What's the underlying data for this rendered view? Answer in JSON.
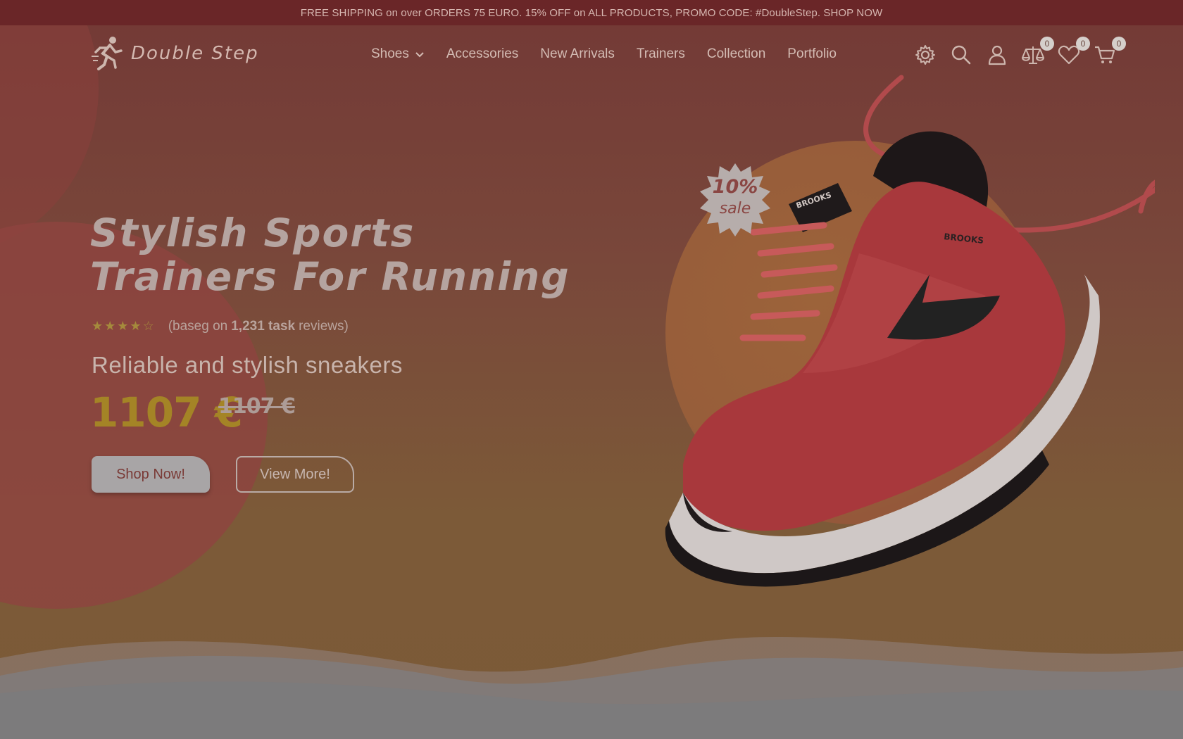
{
  "promo": {
    "text": "FREE SHIPPING on over ORDERS 75 EURO. 15% OFF on ALL PRODUCTS, PROMO CODE: #DoubleStep. SHOP NOW"
  },
  "brand": {
    "name": "Double Step",
    "logo_icon": "runner-icon"
  },
  "nav": {
    "items": [
      {
        "label": "Shoes",
        "has_dropdown": true
      },
      {
        "label": "Accessories"
      },
      {
        "label": "New Arrivals"
      },
      {
        "label": "Trainers"
      },
      {
        "label": "Collection"
      },
      {
        "label": "Portfolio"
      }
    ]
  },
  "header_icons": {
    "settings": {
      "icon": "gear-icon"
    },
    "search": {
      "icon": "search-icon"
    },
    "account": {
      "icon": "user-icon"
    },
    "compare": {
      "icon": "scales-icon",
      "count": "0"
    },
    "wishlist": {
      "icon": "heart-icon",
      "count": "0"
    },
    "cart": {
      "icon": "cart-icon",
      "count": "0"
    }
  },
  "hero": {
    "title_line1": "Stylish Sports",
    "title_line2": "Trainers For Running",
    "rating": {
      "stars_filled": 4,
      "stars_total": 5,
      "text_prefix": "(baseg on",
      "count_text": "1,231 task",
      "text_suffix": "reviews)"
    },
    "subtitle": "Reliable and stylish sneakers",
    "price": "1107 €",
    "old_price": "1107 €",
    "buttons": {
      "shop": "Shop Now!",
      "view": "View More!"
    },
    "sale_badge": {
      "percent": "10%",
      "word": "sale"
    }
  },
  "colors": {
    "promo_bar": "#6a2628",
    "price": "#a48426",
    "star": "#a58a3c",
    "shoe_primary": "#b03a3e"
  }
}
